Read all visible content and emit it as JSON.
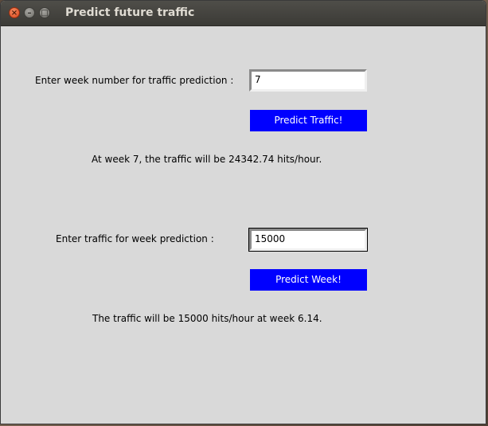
{
  "window": {
    "title": "Predict future traffic"
  },
  "week_section": {
    "label": "Enter week number for traffic prediction :",
    "input_value": "7",
    "button_label": "Predict Traffic!",
    "result": "At week 7, the traffic will be 24342.74 hits/hour."
  },
  "traffic_section": {
    "label": "Enter traffic for week prediction :",
    "input_value": "15000",
    "button_label": "Predict Week!",
    "result": "The traffic will be 15000 hits/hour at week 6.14."
  },
  "colors": {
    "button_bg": "#0000ff",
    "button_text": "#ffffff",
    "window_bg": "#d9d9d9"
  }
}
